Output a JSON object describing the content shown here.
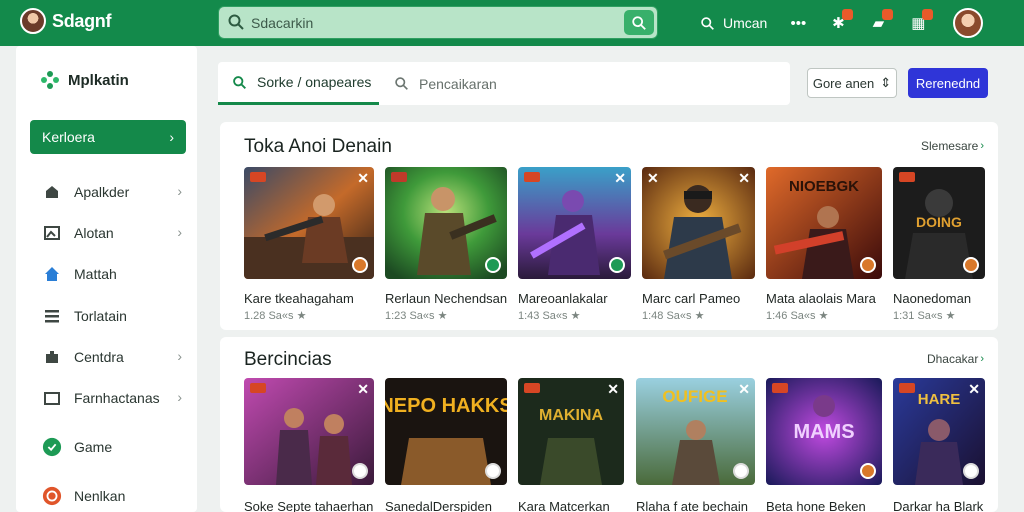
{
  "app": {
    "name": "Sdagnf"
  },
  "top_search": {
    "placeholder": "Sdacarkin"
  },
  "top_nav": {
    "link_label": "Umcan"
  },
  "sidebar": {
    "logo_text": "Mplkatin",
    "cta_label": "Kerloera",
    "items": [
      {
        "label": "Apalkder",
        "icon": "store-icon",
        "chevron": true
      },
      {
        "label": "Alotan",
        "icon": "image-icon",
        "chevron": true
      },
      {
        "label": "Mattah",
        "icon": "home-icon",
        "chevron": false
      },
      {
        "label": "Torlatain",
        "icon": "list-icon",
        "chevron": false
      },
      {
        "label": "Centdra",
        "icon": "puzzle-icon",
        "chevron": true
      },
      {
        "label": "Farnhactanas",
        "icon": "window-icon",
        "chevron": true
      },
      {
        "label": "Game",
        "icon": "game-icon",
        "chevron": false
      },
      {
        "label": "Nenlkan",
        "icon": "shield-icon",
        "chevron": false
      }
    ]
  },
  "filter_bar": {
    "tab_label": "Sorke  /  onapeares",
    "search_placeholder": "Pencaikaran",
    "secondary_button": "Gore anen",
    "primary_button": "Rerenednd"
  },
  "sections": [
    {
      "title": "Toka Anoi Denain",
      "more_label": "Slemesare",
      "cards": [
        {
          "title": "Kare tkeahagaham",
          "meta": "1.28  Sa«s ★"
        },
        {
          "title": "Rerlaun Nechendsan",
          "meta": "1:23  Sa«s ★"
        },
        {
          "title": "Mareoanlakalar",
          "meta": "1:43  Sa«s ★"
        },
        {
          "title": "Marc carl Pameo",
          "meta": "1:48  Sa«s ★"
        },
        {
          "title": "Mata alaolais Mara",
          "meta": "1:46  Sa«s ★"
        },
        {
          "title": "Naonedoman",
          "meta": "1:31  Sa«s ★"
        }
      ]
    },
    {
      "title": "Bercincias",
      "more_label": "Dhacakar",
      "cards": [
        {
          "title": "Soke Septe tahaerhan",
          "art_text": ""
        },
        {
          "title": "SanedalDerspiden",
          "art_text": "NEPO HAKKS"
        },
        {
          "title": "Kara Matcerkan",
          "art_text": "MAKINA"
        },
        {
          "title": "Rlaha f ate bechain",
          "art_text": "OUFIGE"
        },
        {
          "title": "Beta hone Beken",
          "art_text": "MAMS"
        },
        {
          "title": "Darkar ha Blark",
          "art_text": "HARE"
        }
      ]
    }
  ],
  "colors": {
    "topbar": "#138a4b",
    "accent_green": "#14894a",
    "primary_blue": "#2f35d8"
  }
}
